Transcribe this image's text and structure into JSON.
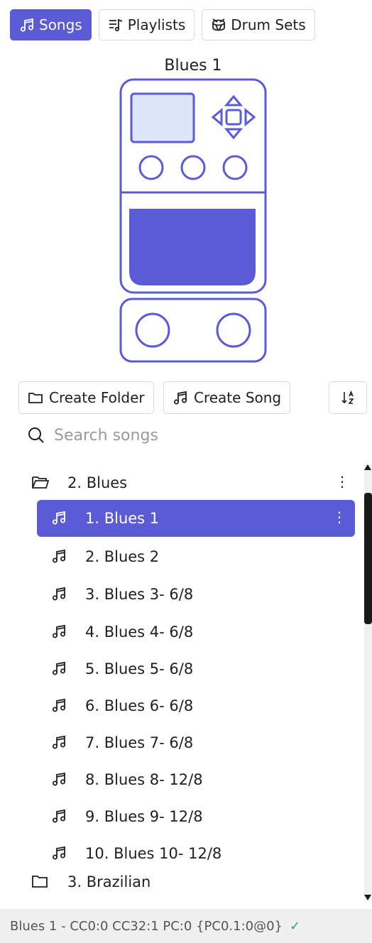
{
  "tabs": [
    {
      "label": "Songs",
      "icon": "music-note-icon",
      "active": true
    },
    {
      "label": "Playlists",
      "icon": "playlist-icon",
      "active": false
    },
    {
      "label": "Drum Sets",
      "icon": "drum-icon",
      "active": false
    }
  ],
  "pedal": {
    "title": "Blues 1"
  },
  "actions": {
    "create_folder": "Create Folder",
    "create_song": "Create Song",
    "sort_icon": "sort-alpha-icon"
  },
  "search": {
    "placeholder": "Search songs",
    "value": ""
  },
  "tree": {
    "folders": [
      {
        "label": "2. Blues",
        "expanded": true
      },
      {
        "label": "3. Brazilian",
        "expanded": false
      }
    ],
    "songs": [
      {
        "label": "1. Blues 1",
        "selected": true
      },
      {
        "label": "2. Blues 2"
      },
      {
        "label": "3. Blues 3- 6/8"
      },
      {
        "label": "4. Blues 4- 6/8"
      },
      {
        "label": "5. Blues 5- 6/8"
      },
      {
        "label": "6. Blues 6- 6/8"
      },
      {
        "label": "7. Blues 7- 6/8"
      },
      {
        "label": "8. Blues 8- 12/8"
      },
      {
        "label": "9. Blues 9- 12/8"
      },
      {
        "label": "10. Blues 10- 12/8"
      }
    ],
    "menu_glyph": "⋮"
  },
  "status": {
    "text": "Blues 1 - CC0:0 CC32:1 PC:0 {PC0.1:0@0}",
    "check": "✓"
  },
  "colors": {
    "accent": "#5b5bd6",
    "lcd": "#dbe6fb",
    "status_ok": "#22b14c"
  }
}
